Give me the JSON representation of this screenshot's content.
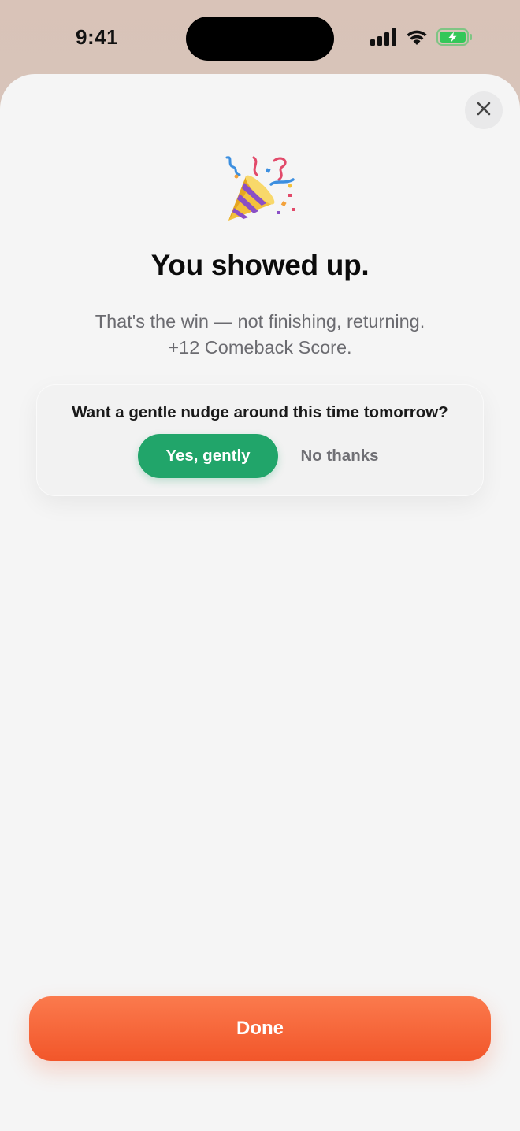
{
  "status_bar": {
    "time": "9:41"
  },
  "icons": {
    "signal": "cellular-signal-icon",
    "wifi": "wifi-icon",
    "battery": "battery-charging-icon",
    "close": "close-icon",
    "celebration": "party-popper-icon"
  },
  "colors": {
    "accent_green": "#21a56a",
    "accent_orange": "#f2562a",
    "battery_green": "#34c759"
  },
  "sheet": {
    "title": "You showed up.",
    "subtitle_line1": "That's the win — not finishing, returning.",
    "subtitle_line2": "+12 Comeback Score."
  },
  "nudge": {
    "question": "Want a gentle nudge around this time tomorrow?",
    "yes_label": "Yes, gently",
    "no_label": "No thanks"
  },
  "footer": {
    "done_label": "Done"
  }
}
